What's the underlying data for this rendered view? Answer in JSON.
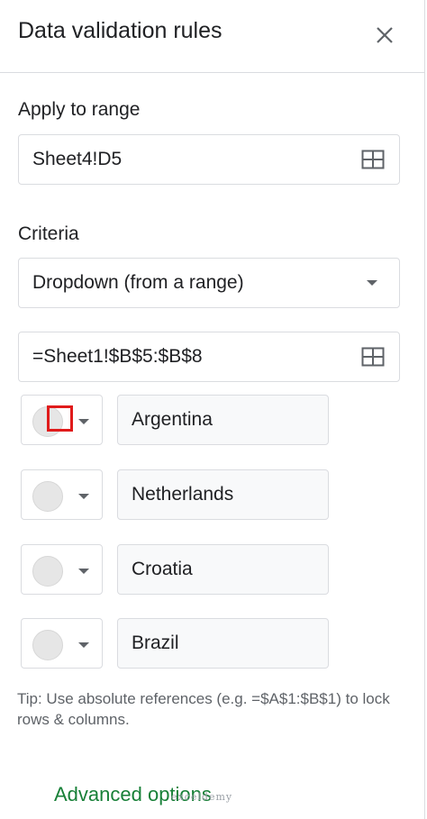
{
  "header": {
    "title": "Data validation rules",
    "close_icon": "close-icon"
  },
  "apply_range": {
    "label": "Apply to range",
    "value": "Sheet4!D5",
    "icon": "grid-icon"
  },
  "criteria": {
    "label": "Criteria",
    "selected": "Dropdown (from a range)",
    "range_value": "=Sheet1!$B$5:$B$8"
  },
  "items": [
    {
      "value": "Argentina",
      "color": "#e6e6e6"
    },
    {
      "value": "Netherlands",
      "color": "#e6e6e6"
    },
    {
      "value": "Croatia",
      "color": "#e6e6e6"
    },
    {
      "value": "Brazil",
      "color": "#e6e6e6"
    }
  ],
  "tip": "Tip: Use absolute references (e.g. =$A$1:$B$1) to lock rows & columns.",
  "advanced_options": "Advanced options",
  "watermark": "exceldemy",
  "colors": {
    "accent_green": "#188038",
    "highlight_red": "#e01b1b",
    "border": "#dadce0"
  }
}
